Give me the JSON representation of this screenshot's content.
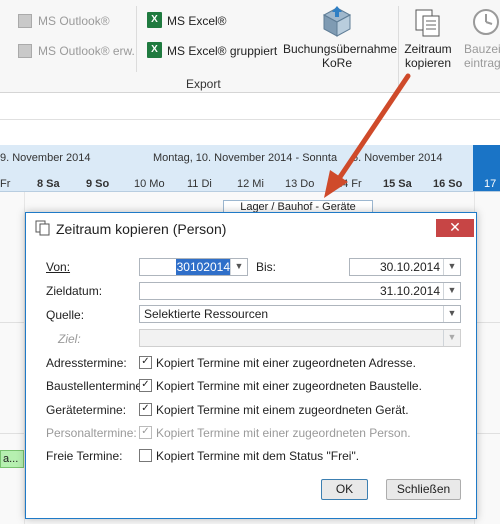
{
  "ribbon": {
    "outlook": "MS Outlook®",
    "outlook_erw": "MS Outlook® erw.",
    "excel": "MS Excel®",
    "excel_grouped": "MS Excel® gruppiert",
    "export_group": "Export",
    "buchung_line1": "Buchungsübernahme",
    "buchung_line2": "KoRe",
    "zeitraum_line1": "Zeitraum",
    "zeitraum_line2": "kopieren",
    "bauzeit_line1": "Bauzeite",
    "bauzeit_line2": "eintrage"
  },
  "calendar": {
    "week_left": "9. November 2014",
    "week_range": "Montag, 10. November 2014 - Sonnta",
    "week_right": "6. November 2014",
    "days": [
      "Fr",
      "8 Sa",
      "9 So",
      "10 Mo",
      "11 Di",
      "12 Mi",
      "13 Do",
      "14 Fr",
      "15 Sa",
      "16 So",
      "17"
    ],
    "appointment": "Lager / Bauhof - Geräte",
    "green_item": "a..."
  },
  "dialog": {
    "title": "Zeitraum kopieren (Person)",
    "close": "✕",
    "von_label": "Von:",
    "von_value": "30102014",
    "bis_label": "Bis:",
    "bis_value": "30.10.2014",
    "zieldatum_label": "Zieldatum:",
    "zieldatum_value": "31.10.2014",
    "quelle_label": "Quelle:",
    "quelle_value": "Selektierte Ressourcen",
    "ziel_label": "Ziel:",
    "ziel_value": "",
    "rows": [
      {
        "label": "Adresstermine:",
        "text": "Kopiert Termine mit einer zugeordneten Adresse.",
        "checked": true,
        "disabled": false
      },
      {
        "label": "Baustellentermine:",
        "text": "Kopiert Termine mit einer zugeordneten Baustelle.",
        "checked": true,
        "disabled": false
      },
      {
        "label": "Gerätetermine:",
        "text": "Kopiert Termine mit einem zugeordneten Gerät.",
        "checked": true,
        "disabled": false
      },
      {
        "label": "Personaltermine:",
        "text": "Kopiert Termine mit einer zugeordneten Person.",
        "checked": true,
        "disabled": true
      },
      {
        "label": "Freie Termine:",
        "text": "Kopiert Termine mit dem Status \"Frei\".",
        "checked": false,
        "disabled": false
      }
    ],
    "ok": "OK",
    "cancel": "Schließen"
  },
  "colors": {
    "accent": "#1f7ac7",
    "arrow": "#cf4a2a",
    "today": "#1a74c6"
  }
}
